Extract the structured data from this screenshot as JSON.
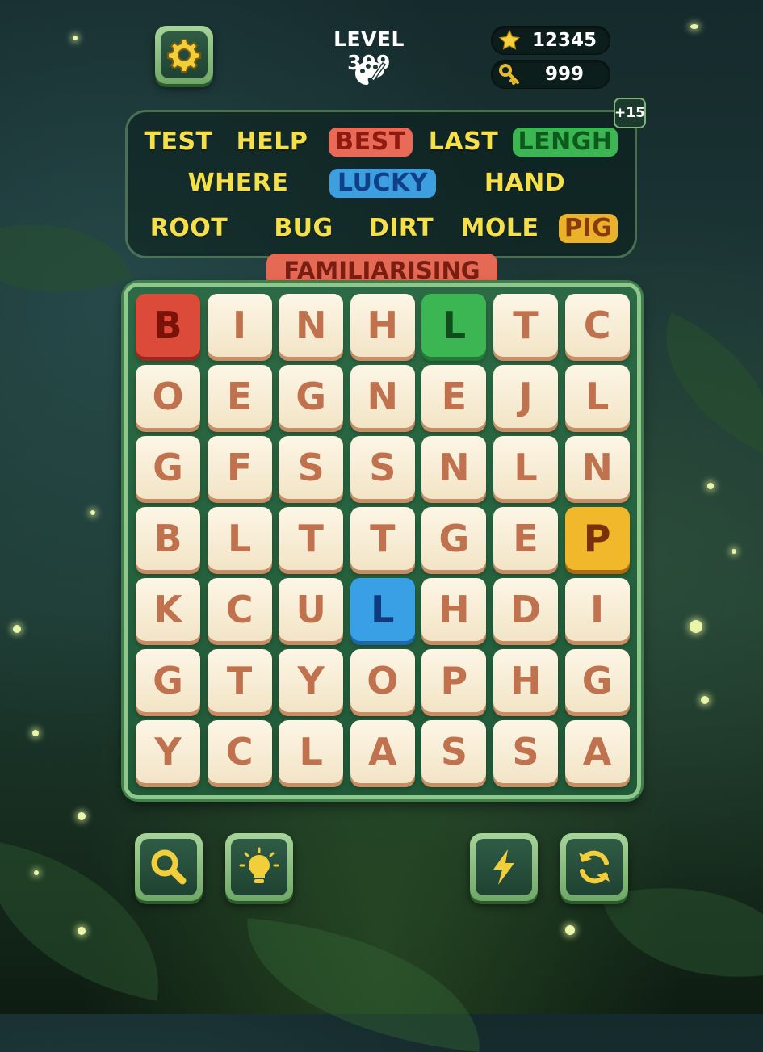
{
  "header": {
    "level_label": "LEVEL 309",
    "stars": "12345",
    "keys": "999"
  },
  "word_panel": {
    "bonus": "+15",
    "rows": [
      [
        {
          "text": "TEST",
          "state": "pending"
        },
        {
          "text": "HELP",
          "state": "pending"
        },
        {
          "text": "BEST",
          "state": "found",
          "color": "#ea6a58",
          "text_color": "#8e1a10"
        },
        {
          "text": "LAST",
          "state": "pending"
        },
        {
          "text": "LENGH",
          "state": "found",
          "color": "#3cb653",
          "text_color": "#0c5a1c"
        }
      ],
      [
        {
          "text": "WHERE",
          "state": "pending"
        },
        {
          "text": "LUCKY",
          "state": "found",
          "color": "#3e9fe0",
          "text_color": "#0f3f86"
        },
        {
          "text": "HAND",
          "state": "pending"
        }
      ],
      [
        {
          "text": "ROOT",
          "state": "pending"
        },
        {
          "text": "BUG",
          "state": "pending"
        },
        {
          "text": "DIRT",
          "state": "pending"
        },
        {
          "text": "MOLE",
          "state": "pending"
        },
        {
          "text": "PIG",
          "state": "found",
          "color": "#eab22a",
          "text_color": "#8a3a0a"
        }
      ]
    ]
  },
  "current_word": "FAMILIARISING",
  "grid": [
    [
      "B",
      "I",
      "N",
      "H",
      "L",
      "T",
      "C"
    ],
    [
      "O",
      "E",
      "G",
      "N",
      "E",
      "J",
      "L"
    ],
    [
      "G",
      "F",
      "S",
      "S",
      "N",
      "L",
      "N"
    ],
    [
      "B",
      "L",
      "T",
      "T",
      "G",
      "E",
      "P"
    ],
    [
      "K",
      "C",
      "U",
      "L",
      "H",
      "D",
      "I"
    ],
    [
      "G",
      "T",
      "Y",
      "O",
      "P",
      "H",
      "G"
    ],
    [
      "Y",
      "C",
      "L",
      "A",
      "S",
      "S",
      "A"
    ]
  ],
  "highlights": [
    {
      "row": 0,
      "col": 0,
      "color": "#dc4a3a",
      "shade": "#9a2a1e",
      "text_color": "#7a1208"
    },
    {
      "row": 0,
      "col": 4,
      "color": "#3cb653",
      "shade": "#237a35",
      "text_color": "#0e4e1a"
    },
    {
      "row": 3,
      "col": 6,
      "color": "#f0b82a",
      "shade": "#b06a10",
      "text_color": "#7a3008"
    },
    {
      "row": 4,
      "col": 3,
      "color": "#3aa0e6",
      "shade": "#1e68a8",
      "text_color": "#0e3a80"
    }
  ],
  "icons": {
    "settings": "gear-icon",
    "level_theme": "palette-icon",
    "stars": "star-icon",
    "keys": "key-icon",
    "search": "magnifier-icon",
    "hint": "lightbulb-icon",
    "boost": "lightning-icon",
    "shuffle": "refresh-icon"
  },
  "colors": {
    "word_text": "#f6e04a",
    "tile_face": "#fdf6e6",
    "tile_letter": "#c0714d",
    "board_border": "#8ec88a",
    "icon_gold": "#f2cf3a"
  }
}
